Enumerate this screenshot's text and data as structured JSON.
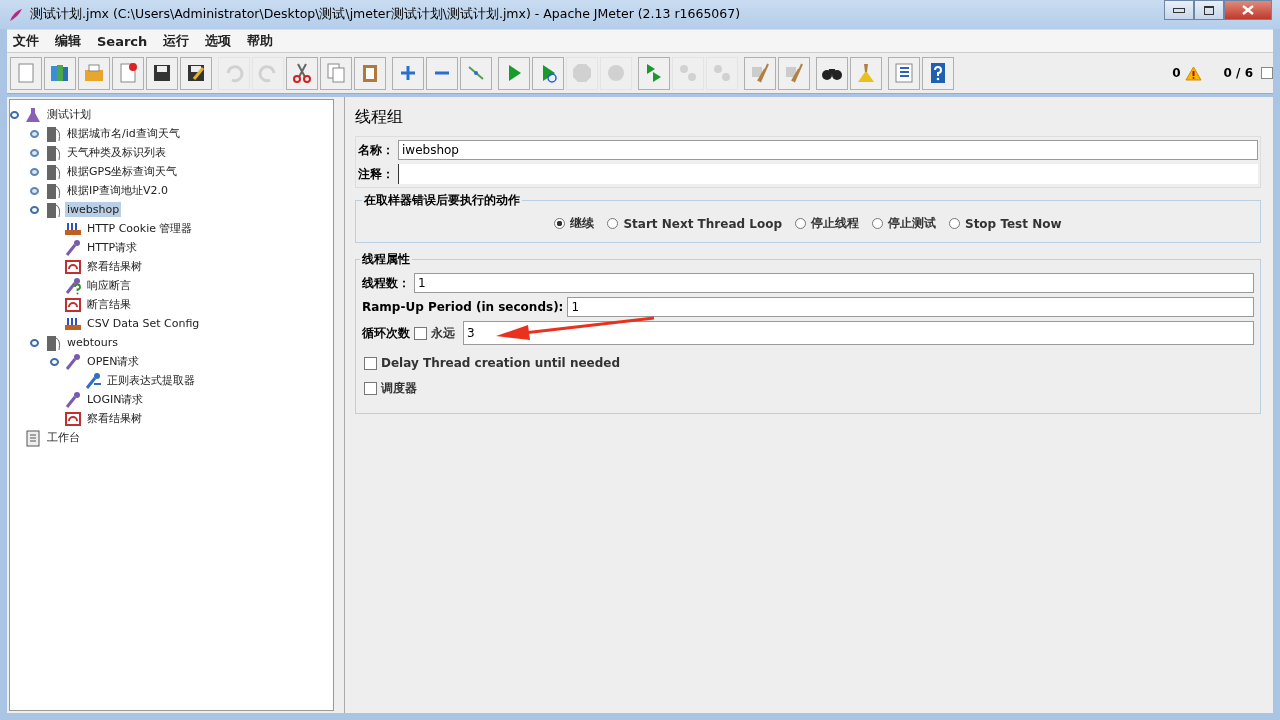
{
  "window": {
    "title": "测试计划.jmx (C:\\Users\\Administrator\\Desktop\\测试\\jmeter测试计划\\测试计划.jmx) - Apache JMeter (2.13 r1665067)"
  },
  "menu": [
    "文件",
    "编辑",
    "Search",
    "运行",
    "选项",
    "帮助"
  ],
  "toolbar": [
    [
      {
        "kind": "new",
        "disabled": false
      },
      {
        "kind": "templates",
        "disabled": false
      },
      {
        "kind": "open",
        "disabled": false
      },
      {
        "kind": "close",
        "disabled": false
      },
      {
        "kind": "save",
        "disabled": false
      },
      {
        "kind": "save-as",
        "disabled": false
      }
    ],
    [
      {
        "kind": "undo",
        "disabled": true
      },
      {
        "kind": "redo",
        "disabled": true
      },
      {
        "kind": "cut",
        "disabled": false
      },
      {
        "kind": "copy",
        "disabled": false
      },
      {
        "kind": "paste",
        "disabled": false
      }
    ],
    [
      {
        "kind": "expand",
        "disabled": false
      },
      {
        "kind": "collapse",
        "disabled": false
      },
      {
        "kind": "toggle",
        "disabled": false
      }
    ],
    [
      {
        "kind": "start",
        "disabled": false
      },
      {
        "kind": "start-no-pause",
        "disabled": false
      },
      {
        "kind": "stop",
        "disabled": true
      },
      {
        "kind": "shutdown",
        "disabled": true
      }
    ],
    [
      {
        "kind": "remote-start",
        "disabled": false
      },
      {
        "kind": "remote-stop",
        "disabled": true
      },
      {
        "kind": "remote-shutdown",
        "disabled": true
      }
    ],
    [
      {
        "kind": "clear",
        "disabled": false
      },
      {
        "kind": "clear-all",
        "disabled": false
      }
    ],
    [
      {
        "kind": "search",
        "disabled": false
      },
      {
        "kind": "reset-search",
        "disabled": false
      }
    ],
    [
      {
        "kind": "function-helper",
        "disabled": false
      },
      {
        "kind": "help",
        "disabled": false
      }
    ]
  ],
  "status": {
    "warnings": "0",
    "threads": "0 / 6"
  },
  "tree": [
    {
      "label": "测试计划",
      "kind": "plan",
      "selected": false,
      "children": [
        {
          "label": "根据城市名/id查询天气",
          "kind": "threadgroup",
          "selected": false,
          "expanded": false
        },
        {
          "label": "天气种类及标识列表",
          "kind": "threadgroup",
          "selected": false,
          "expanded": false
        },
        {
          "label": "根据GPS坐标查询天气",
          "kind": "threadgroup",
          "selected": false,
          "expanded": false
        },
        {
          "label": "根据IP查询地址V2.0",
          "kind": "threadgroup",
          "selected": false,
          "expanded": false
        },
        {
          "label": "iwebshop",
          "kind": "threadgroup",
          "selected": true,
          "children": [
            {
              "label": "HTTP Cookie 管理器",
              "kind": "config",
              "selected": false
            },
            {
              "label": "HTTP请求",
              "kind": "sampler",
              "selected": false
            },
            {
              "label": "察看结果树",
              "kind": "listener",
              "selected": false
            },
            {
              "label": "响应断言",
              "kind": "assertion",
              "selected": false
            },
            {
              "label": "断言结果",
              "kind": "listener",
              "selected": false
            },
            {
              "label": "CSV Data Set Config",
              "kind": "config",
              "selected": false
            }
          ]
        },
        {
          "label": "webtours",
          "kind": "threadgroup",
          "selected": false,
          "children": [
            {
              "label": "OPEN请求",
              "kind": "sampler",
              "selected": false,
              "children": [
                {
                  "label": "正则表达式提取器",
                  "kind": "extractor",
                  "selected": false
                }
              ]
            },
            {
              "label": "LOGIN请求",
              "kind": "sampler",
              "selected": false
            },
            {
              "label": "察看结果树",
              "kind": "listener",
              "selected": false
            }
          ]
        }
      ]
    },
    {
      "label": "工作台",
      "kind": "workbench",
      "selected": false
    }
  ],
  "panel": {
    "title": "线程组",
    "name_label": "名称：",
    "name_value": "iwebshop",
    "comment_label": "注释：",
    "error_group": {
      "title": "在取样器错误后要执行的动作",
      "options": [
        {
          "label": "继续",
          "selected": true
        },
        {
          "label": "Start Next Thread Loop",
          "selected": false
        },
        {
          "label": "停止线程",
          "selected": false
        },
        {
          "label": "停止测试",
          "selected": false
        },
        {
          "label": "Stop Test Now",
          "selected": false
        }
      ]
    },
    "thread_group": {
      "title": "线程属性",
      "threads_label": "线程数：",
      "threads_value": "1",
      "rampup_label": "Ramp-Up Period (in seconds):",
      "rampup_value": "1",
      "loop_label": "循环次数",
      "forever": {
        "label": "永远",
        "checked": false
      },
      "loop_value": "3",
      "delay": {
        "label": "Delay Thread creation until needed",
        "checked": false
      },
      "scheduler": {
        "label": "调度器",
        "checked": false
      }
    }
  }
}
